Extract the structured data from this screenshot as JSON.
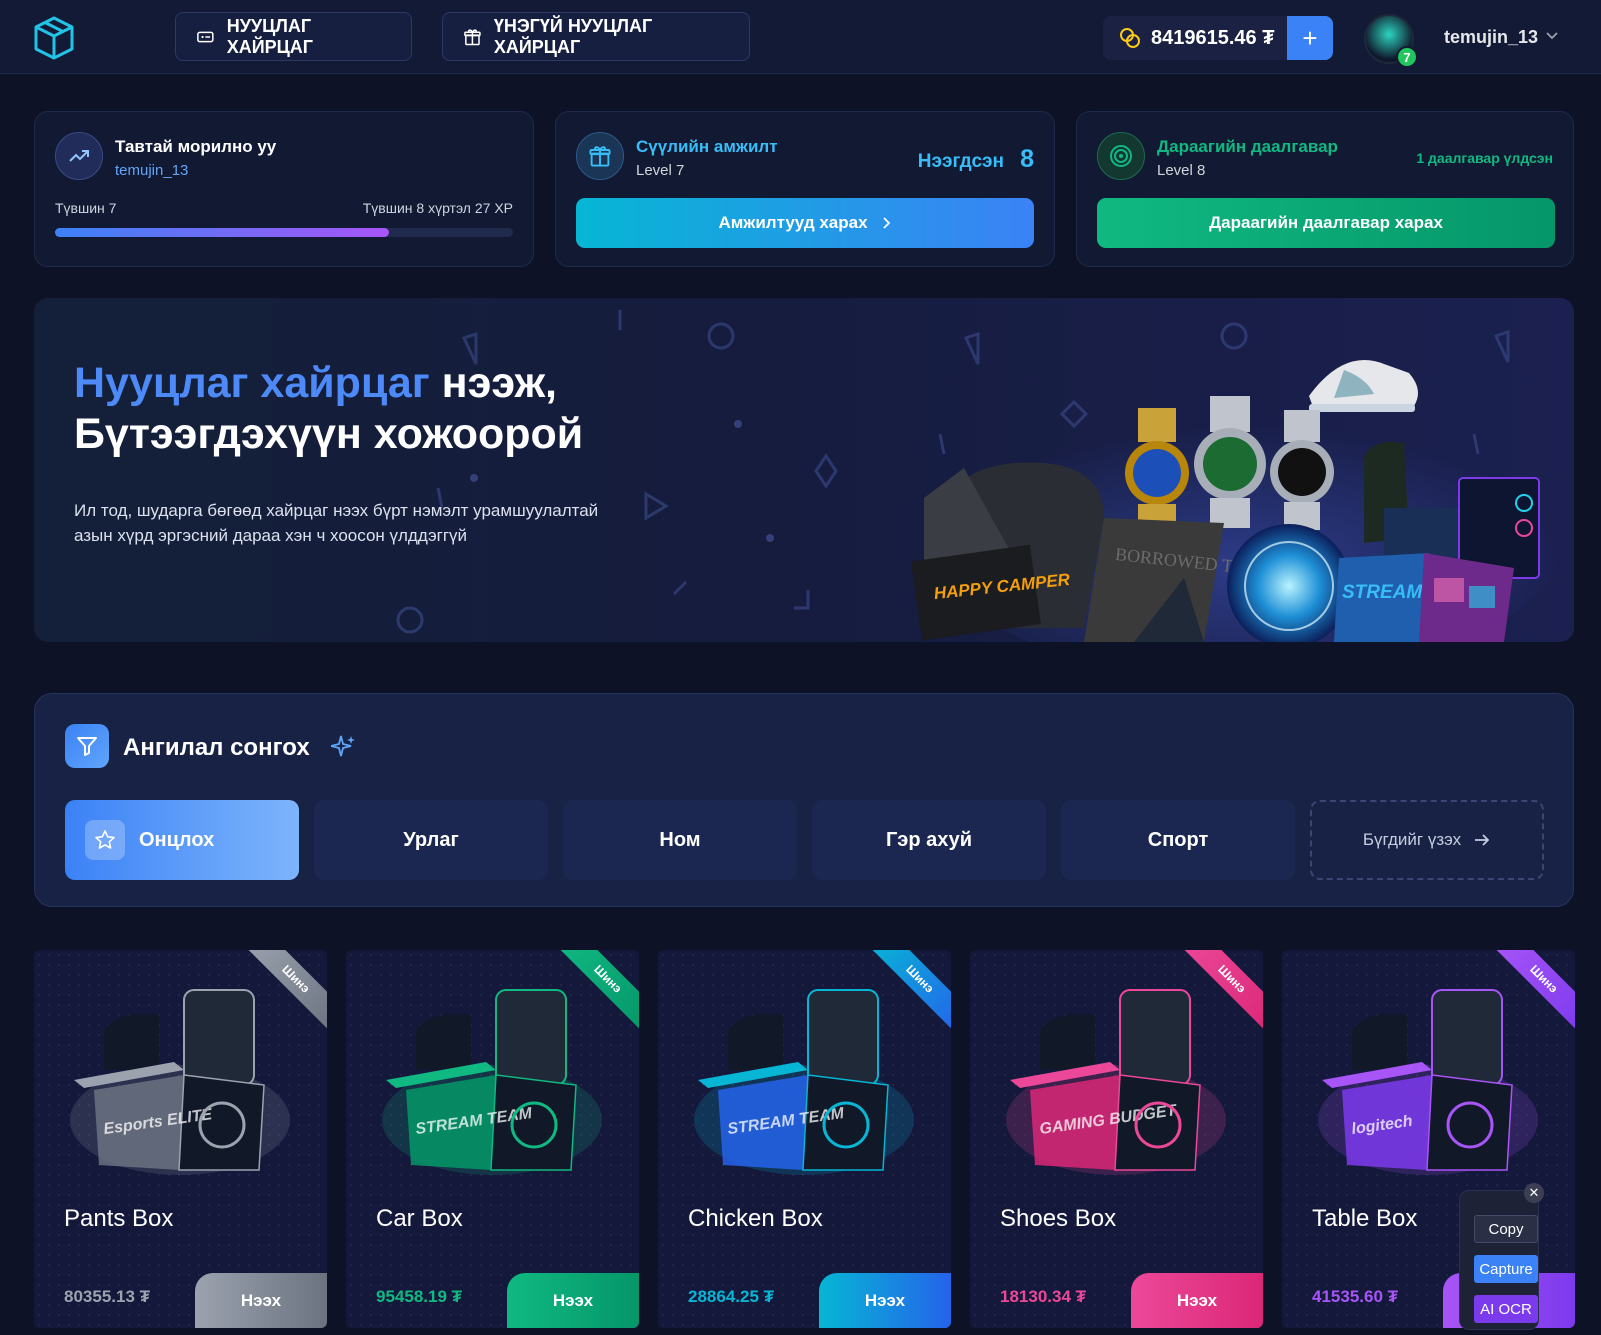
{
  "header": {
    "nav": [
      "НУУЦЛАГ ХАЙРЦАГ",
      "ҮНЭГҮЙ НУУЦЛАГ ХАЙРЦАГ"
    ],
    "balance": "8419615.46 ₮",
    "plus": "+",
    "avatar_level": "7",
    "username": "temujin_13"
  },
  "welcome": {
    "title": "Тавтай морилно уу",
    "username": "temujin_13",
    "level_left": "Түвшин 7",
    "level_right": "Түвшин 8 хүртэл 27 XP",
    "progress": 0.73
  },
  "achievement": {
    "title": "Сүүлийн амжилт",
    "level": "Level 7",
    "open_label": "Нээгдсэн",
    "open_count": "8",
    "button": "Амжилтууд харах"
  },
  "task": {
    "title": "Дараагийн даалгавар",
    "level": "Level 8",
    "remaining": "1 даалгавар үлдсэн",
    "button": "Дараагийн даалгавар харах"
  },
  "hero": {
    "title_accent": "Нууцлаг хайрцаг",
    "title_rest": " нээж,",
    "title_line2": "Бүтээгдэхүүн хожоорой",
    "desc": "Ил тод, шударга бөгөөд хайрцаг нээх бүрт нэмэлт урамшуулалтай азын хүрд эргэсний дараа хэн ч хоосон үлддэггүй",
    "box_labels": [
      "HAPPY CAMPER",
      "BORROWED TIME",
      "STREAM TEAM"
    ]
  },
  "categories": {
    "title": "Ангилал сонгох",
    "items": [
      "Онцлох",
      "Урлаг",
      "Ном",
      "Гэр ахуй",
      "Спорт"
    ],
    "view_all": "Бүгдийг үзэх"
  },
  "boxes": [
    {
      "name": "Pants Box",
      "price": "80355.13 ₮",
      "button": "Нээх",
      "badge": "Шинэ",
      "accent": "#9ca3af",
      "art_text": "Esports ELITE"
    },
    {
      "name": "Car Box",
      "price": "95458.19 ₮",
      "button": "Нээх",
      "badge": "Шинэ",
      "accent": "#10b981",
      "art_text": "STREAM TEAM"
    },
    {
      "name": "Chicken Box",
      "price": "28864.25 ₮",
      "button": "Нээх",
      "badge": "Шинэ",
      "accent": "#06b6d4",
      "art_text": "STREAM TEAM"
    },
    {
      "name": "Shoes Box",
      "price": "18130.34 ₮",
      "button": "Нээх",
      "badge": "Шинэ",
      "accent": "#ec4899",
      "art_text": "GAMING BUDGET"
    },
    {
      "name": "Table Box",
      "price": "41535.60 ₮",
      "button": "Нээх",
      "badge": "Шинэ",
      "accent": "#a855f7",
      "art_text": "logitech"
    }
  ],
  "ocr_popup": {
    "close": "✕",
    "buttons": [
      "Copy",
      "Capture",
      "AI OCR"
    ]
  }
}
